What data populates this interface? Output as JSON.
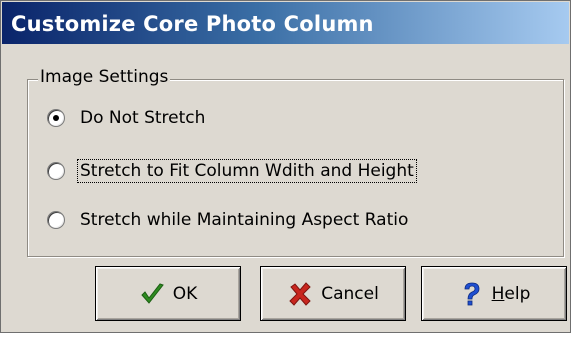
{
  "window": {
    "title": "Customize Core Photo Column"
  },
  "group": {
    "legend": "Image Settings",
    "options": [
      {
        "label": "Do Not Stretch",
        "selected": true
      },
      {
        "label": "Stretch to Fit Column Wdith and Height",
        "selected": false
      },
      {
        "label": "Stretch while Maintaining Aspect Ratio",
        "selected": false
      }
    ]
  },
  "buttons": {
    "ok": {
      "label": "OK",
      "icon": "checkmark-icon",
      "color": "#2e8b20"
    },
    "cancel": {
      "label": "Cancel",
      "icon": "red-x-icon",
      "color": "#c8261e"
    },
    "help": {
      "label_mnemonic": "H",
      "label_rest": "elp",
      "icon": "question-mark-icon",
      "color": "#1f4fd1"
    }
  }
}
